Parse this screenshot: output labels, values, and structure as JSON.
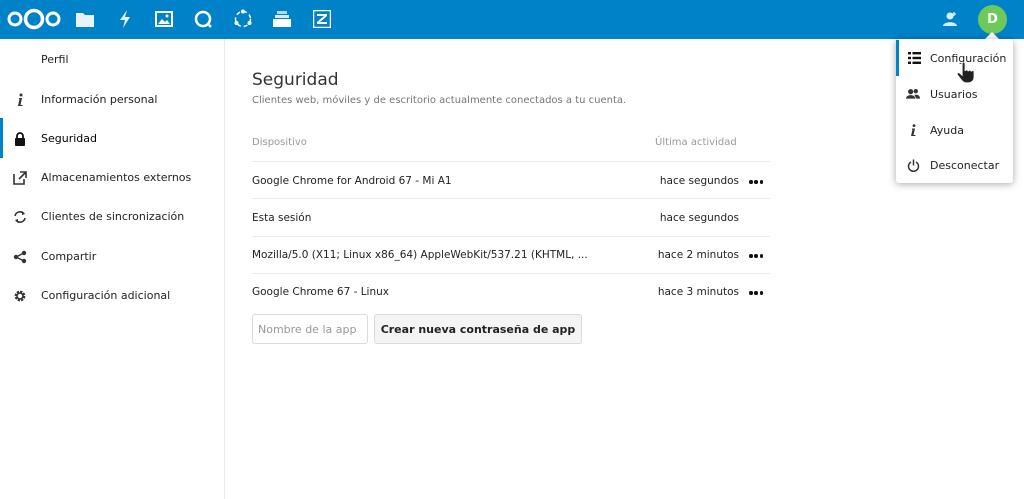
{
  "header": {
    "avatar_initial": "D",
    "brand_color": "#0082c9",
    "apps": [
      "files-icon",
      "activity-icon",
      "gallery-icon",
      "talk-icon",
      "circles-icon",
      "deck-icon",
      "zammad-icon"
    ]
  },
  "sidebar": {
    "section_title": "Perfil",
    "items": [
      {
        "label": "Información personal",
        "icon": "info-icon"
      },
      {
        "label": "Seguridad",
        "icon": "lock-icon",
        "active": true
      },
      {
        "label": "Almacenamientos externos",
        "icon": "external-link-icon"
      },
      {
        "label": "Clientes de sincronización",
        "icon": "sync-icon"
      },
      {
        "label": "Compartir",
        "icon": "share-icon"
      },
      {
        "label": "Configuración adicional",
        "icon": "gear-icon"
      }
    ]
  },
  "main": {
    "title": "Seguridad",
    "description": "Clientes web, móviles y de escritorio actualmente conectados a tu cuenta.",
    "table": {
      "columns": [
        "Dispositivo",
        "Última actividad"
      ],
      "rows": [
        {
          "device": "Google Chrome for Android 67 - Mi A1",
          "activity": "hace segundos",
          "has_menu": true
        },
        {
          "device": "Esta sesión",
          "activity": "hace segundos",
          "has_menu": false
        },
        {
          "device": "Mozilla/5.0 (X11; Linux x86_64) AppleWebKit/537.21 (KHTML, ...",
          "activity": "hace 2 minutos",
          "has_menu": true
        },
        {
          "device": "Google Chrome 67 - Linux",
          "activity": "hace 3 minutos",
          "has_menu": true
        }
      ]
    },
    "app_name_placeholder": "Nombre de la app",
    "create_button": "Crear nueva contraseña de app"
  },
  "menu": {
    "items": [
      {
        "label": "Configuración",
        "icon": "settings-list-icon",
        "active": true
      },
      {
        "label": "Usuarios",
        "icon": "users-icon"
      },
      {
        "label": "Ayuda",
        "icon": "info-icon"
      },
      {
        "label": "Desconectar",
        "icon": "power-icon"
      }
    ]
  }
}
